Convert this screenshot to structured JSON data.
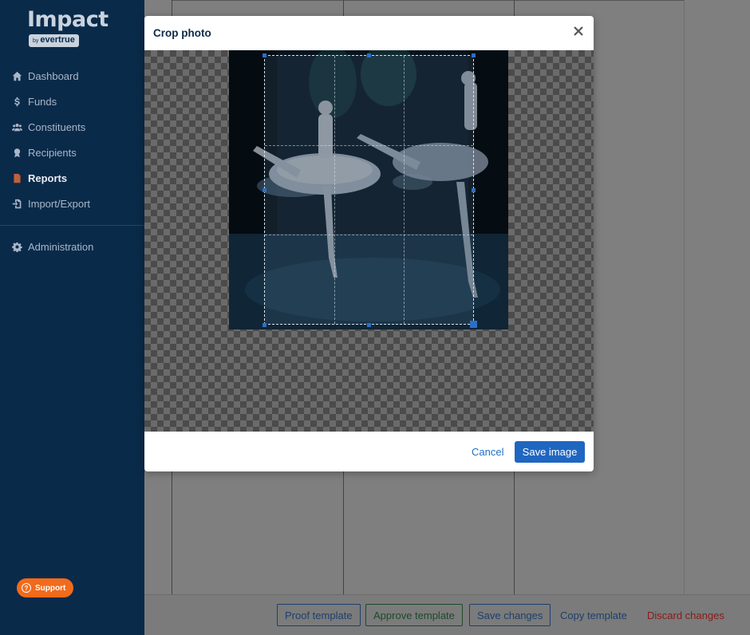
{
  "app": {
    "logo_title": "Impact",
    "logo_by": "by",
    "logo_brand": "evertrue"
  },
  "sidebar": {
    "items": [
      {
        "label": "Dashboard",
        "icon": "home-icon"
      },
      {
        "label": "Funds",
        "icon": "dollar-icon"
      },
      {
        "label": "Constituents",
        "icon": "users-icon"
      },
      {
        "label": "Recipients",
        "icon": "award-icon"
      },
      {
        "label": "Reports",
        "icon": "report-icon",
        "active": true
      },
      {
        "label": "Import/Export",
        "icon": "import-export-icon"
      }
    ],
    "admin": {
      "label": "Administration",
      "icon": "gear-icon"
    },
    "support_label": "Support"
  },
  "modal": {
    "title": "Crop photo",
    "cancel_label": "Cancel",
    "save_label": "Save image"
  },
  "footer": {
    "proof_label": "Proof template",
    "approve_label": "Approve template",
    "save_label": "Save changes",
    "copy_label": "Copy template",
    "discard_label": "Discard changes"
  },
  "colors": {
    "sidebar_bg": "#0a2a4a",
    "primary": "#1f66c1",
    "support": "#f26a1b",
    "danger": "#8a1a1a"
  }
}
